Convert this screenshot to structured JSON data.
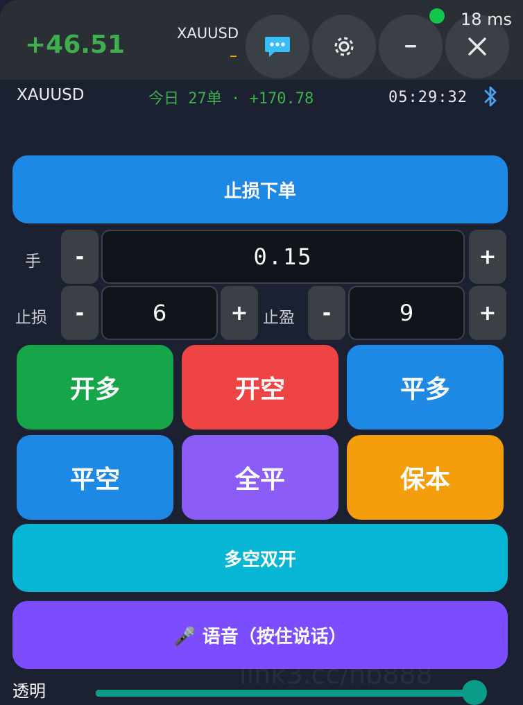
{
  "header": {
    "watermark": "link3.cc/nb888",
    "pnl": "+46.51",
    "symbol": "XAUUSD",
    "symbol_sub": "_",
    "ping": "18 ms",
    "ping_color": "#12c64a",
    "buttons": [
      "chat-icon",
      "gear-icon",
      "minus-icon",
      "close-icon"
    ]
  },
  "info": {
    "symbol": "XAUUSD",
    "today": "今日 27单 · +170.78",
    "time": "05:29:32",
    "bluetooth_icon": "bluetooth-icon"
  },
  "sl_order": {
    "label": "止损下单",
    "color": "#1e88e5"
  },
  "lots": {
    "label": "手",
    "value": "0.15",
    "minus": "-",
    "plus": "+"
  },
  "stop_loss": {
    "label": "止损",
    "value": "6",
    "minus": "-",
    "plus": "+"
  },
  "take_profit": {
    "label": "止盈",
    "value": "9",
    "minus": "-",
    "plus": "+"
  },
  "actions": {
    "open_long": "开多",
    "open_short": "开空",
    "close_long": "平多",
    "close_short": "平空",
    "close_all": "全平",
    "break_even": "保本"
  },
  "colors": {
    "open_long": "#17a54a",
    "open_short": "#ef4444",
    "close_long": "#1e88e5",
    "close_short": "#1e88e5",
    "close_all": "#8b5cf6",
    "break_even": "#f59e0b",
    "hedge": "#06b6d4",
    "voice": "#7c4dff"
  },
  "hedge": {
    "label": "多空双开"
  },
  "voice": {
    "label": "🎤 语音（按住说话）"
  },
  "opacity": {
    "label": "透明"
  }
}
